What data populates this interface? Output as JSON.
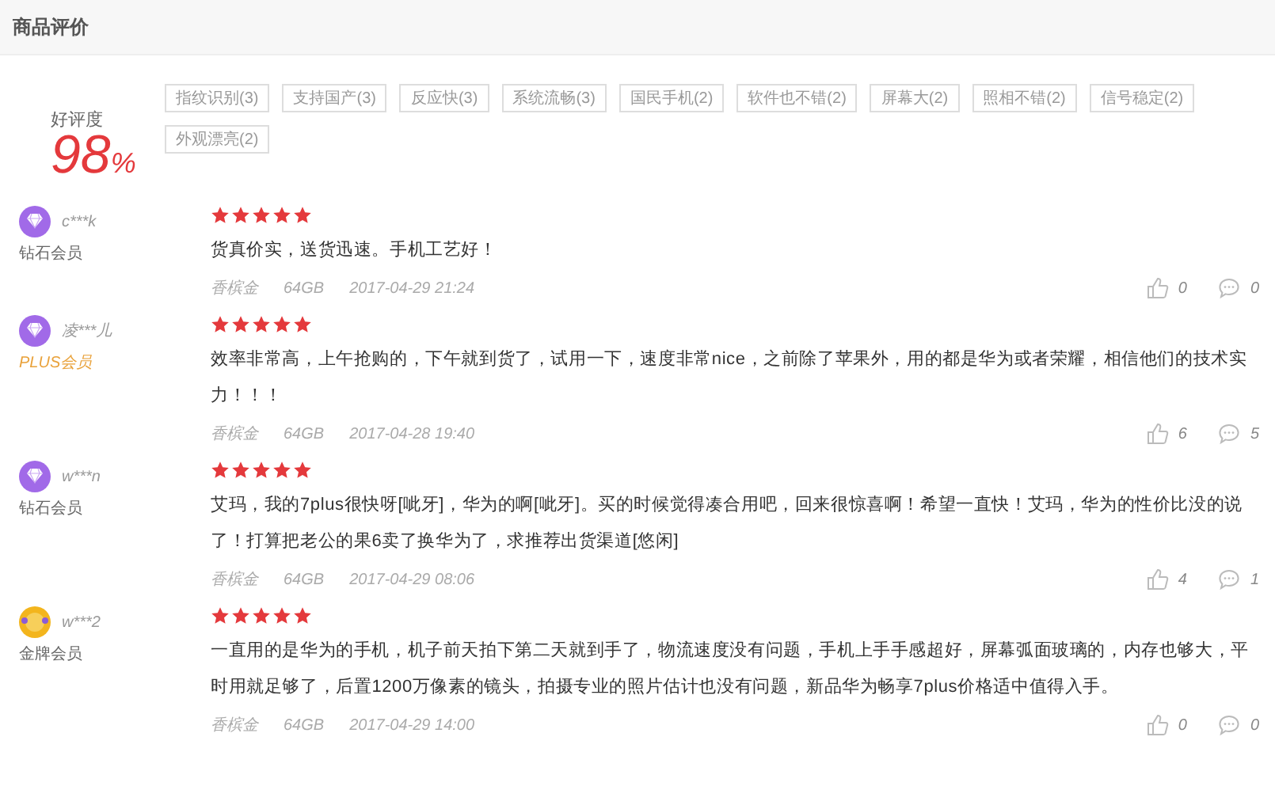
{
  "section_title": "商品评价",
  "rating": {
    "label": "好评度",
    "value": "98",
    "unit": "%"
  },
  "tags": [
    {
      "label": "指纹识别(3)"
    },
    {
      "label": "支持国产(3)"
    },
    {
      "label": "反应快(3)"
    },
    {
      "label": "系统流畅(3)"
    },
    {
      "label": "国民手机(2)"
    },
    {
      "label": "软件也不错(2)"
    },
    {
      "label": "屏幕大(2)"
    },
    {
      "label": "照相不错(2)"
    },
    {
      "label": "信号稳定(2)"
    },
    {
      "label": "外观漂亮(2)"
    }
  ],
  "reviews": [
    {
      "user": "c***k",
      "member": {
        "kind": "diamond",
        "label": "钻石会员"
      },
      "stars": 5,
      "content": "货真价实，送货迅速。手机工艺好！",
      "color_option": "香槟金",
      "storage": "64GB",
      "date": "2017-04-29 21:24",
      "likes": "0",
      "comments": "0"
    },
    {
      "user": "凌***儿",
      "member": {
        "kind": "plus",
        "label": "PLUS会员"
      },
      "stars": 5,
      "content": "效率非常高，上午抢购的，下午就到货了，试用一下，速度非常nice，之前除了苹果外，用的都是华为或者荣耀，相信他们的技术实力！！！",
      "color_option": "香槟金",
      "storage": "64GB",
      "date": "2017-04-28 19:40",
      "likes": "6",
      "comments": "5"
    },
    {
      "user": "w***n",
      "member": {
        "kind": "diamond",
        "label": "钻石会员"
      },
      "stars": 5,
      "content": "艾玛，我的7plus很快呀[呲牙]，华为的啊[呲牙]。买的时候觉得凑合用吧，回来很惊喜啊！希望一直快！艾玛，华为的性价比没的说了！打算把老公的果6卖了换华为了，求推荐出货渠道[悠闲]",
      "color_option": "香槟金",
      "storage": "64GB",
      "date": "2017-04-29 08:06",
      "likes": "4",
      "comments": "1"
    },
    {
      "user": "w***2",
      "member": {
        "kind": "gold",
        "label": "金牌会员"
      },
      "stars": 5,
      "content": "一直用的是华为的手机，机子前天拍下第二天就到手了，物流速度没有问题，手机上手手感超好，屏幕弧面玻璃的，内存也够大，平时用就足够了，后置1200万像素的镜头，拍摄专业的照片估计也没有问题，新品华为畅享7plus价格适中值得入手。",
      "color_option": "香槟金",
      "storage": "64GB",
      "date": "2017-04-29 14:00",
      "likes": "0",
      "comments": "0"
    }
  ]
}
